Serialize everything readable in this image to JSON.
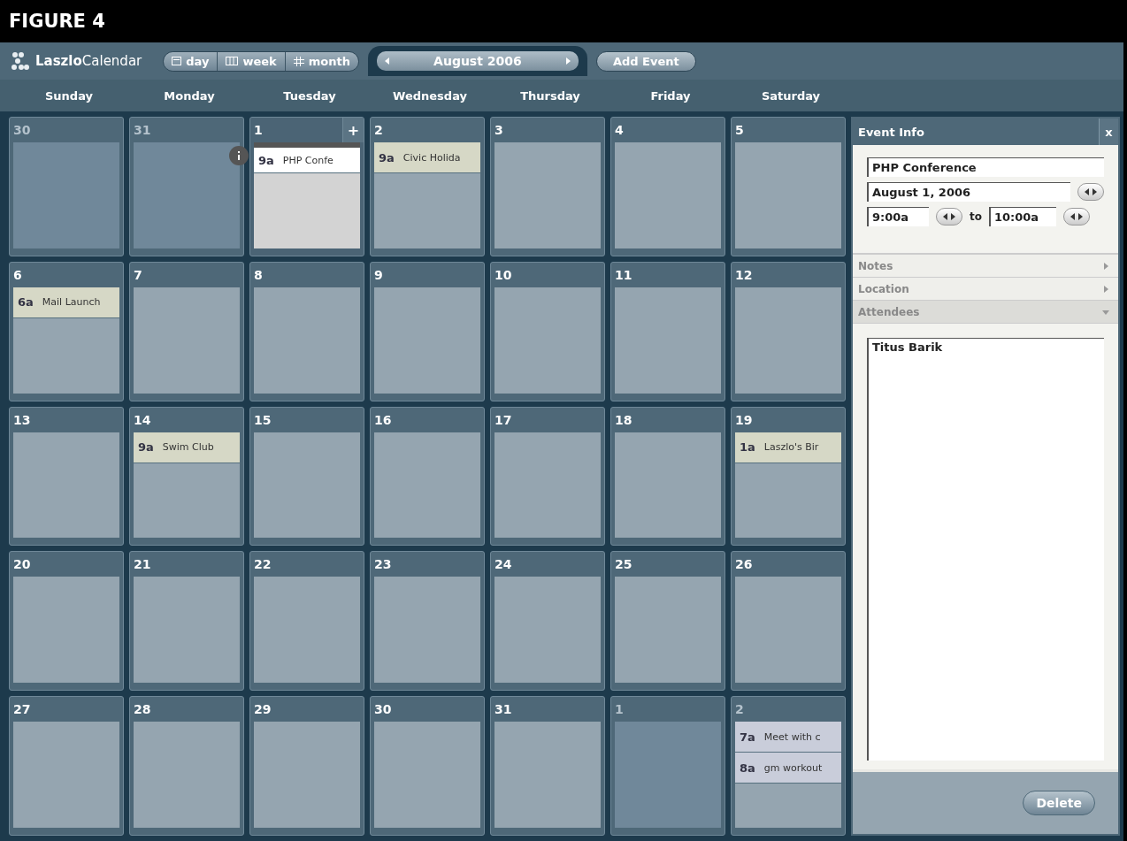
{
  "caption": "FIGURE 4",
  "toolbar": {
    "logo": "Laszlo",
    "logo_suffix": "Calendar",
    "views": [
      {
        "label": "day"
      },
      {
        "label": "week"
      },
      {
        "label": "month"
      }
    ],
    "period": "August 2006",
    "add_button": "Add Event"
  },
  "weekdays": [
    "Sunday",
    "Monday",
    "Tuesday",
    "Wednesday",
    "Thursday",
    "Friday",
    "Saturday"
  ],
  "weeks": [
    [
      {
        "day": "30",
        "muted": true,
        "selected": false
      },
      {
        "day": "31",
        "muted": true,
        "selected": false
      },
      {
        "day": "1",
        "muted": false,
        "selected": true,
        "add_label": "+",
        "events": [
          {
            "time": "9a",
            "title": "PHP Confe",
            "selected": true,
            "color": "#ffffff"
          }
        ]
      },
      {
        "day": "2",
        "muted": false,
        "selected": false,
        "events": [
          {
            "time": "9a",
            "title": "Civic Holida",
            "selected": false,
            "color": "#d6d8c6"
          }
        ]
      },
      {
        "day": "3",
        "muted": false,
        "selected": false
      },
      {
        "day": "4",
        "muted": false,
        "selected": false
      },
      {
        "day": "5",
        "muted": false,
        "selected": false
      }
    ],
    [
      {
        "day": "6",
        "muted": false,
        "selected": false,
        "events": [
          {
            "time": "6a",
            "title": "Mail Launch",
            "selected": false,
            "color": "#d6d8c6"
          }
        ]
      },
      {
        "day": "7",
        "muted": false,
        "selected": false
      },
      {
        "day": "8",
        "muted": false,
        "selected": false
      },
      {
        "day": "9",
        "muted": false,
        "selected": false
      },
      {
        "day": "10",
        "muted": false,
        "selected": false
      },
      {
        "day": "11",
        "muted": false,
        "selected": false
      },
      {
        "day": "12",
        "muted": false,
        "selected": false
      }
    ],
    [
      {
        "day": "13",
        "muted": false,
        "selected": false
      },
      {
        "day": "14",
        "muted": false,
        "selected": false,
        "events": [
          {
            "time": "9a",
            "title": "Swim Club",
            "selected": false,
            "color": "#d6d8c6"
          }
        ]
      },
      {
        "day": "15",
        "muted": false,
        "selected": false
      },
      {
        "day": "16",
        "muted": false,
        "selected": false
      },
      {
        "day": "17",
        "muted": false,
        "selected": false
      },
      {
        "day": "18",
        "muted": false,
        "selected": false
      },
      {
        "day": "19",
        "muted": false,
        "selected": false,
        "events": [
          {
            "time": "1a",
            "title": "Laszlo's Bir",
            "selected": false,
            "color": "#d6d8c6"
          }
        ]
      }
    ],
    [
      {
        "day": "20",
        "muted": false,
        "selected": false
      },
      {
        "day": "21",
        "muted": false,
        "selected": false
      },
      {
        "day": "22",
        "muted": false,
        "selected": false
      },
      {
        "day": "23",
        "muted": false,
        "selected": false
      },
      {
        "day": "24",
        "muted": false,
        "selected": false
      },
      {
        "day": "25",
        "muted": false,
        "selected": false
      },
      {
        "day": "26",
        "muted": false,
        "selected": false
      }
    ],
    [
      {
        "day": "27",
        "muted": false,
        "selected": false
      },
      {
        "day": "28",
        "muted": false,
        "selected": false
      },
      {
        "day": "29",
        "muted": false,
        "selected": false
      },
      {
        "day": "30",
        "muted": false,
        "selected": false
      },
      {
        "day": "31",
        "muted": false,
        "selected": false
      },
      {
        "day": "1",
        "muted": true,
        "selected": false
      },
      {
        "day": "2",
        "muted": true,
        "selected": false,
        "events": [
          {
            "time": "7a",
            "title": "Meet with c",
            "selected": false,
            "color": "#c9cdda"
          },
          {
            "time": "8a",
            "title": "gm workout",
            "selected": false,
            "color": "#c9cdda"
          }
        ]
      }
    ]
  ],
  "event_info": {
    "title": "Event Info",
    "close": "x",
    "name": "PHP Conference",
    "date": "August 1, 2006",
    "start": "9:00a",
    "to": "to",
    "end": "10:00a",
    "sections": [
      {
        "label": "Notes",
        "expanded": false
      },
      {
        "label": "Location",
        "expanded": false
      },
      {
        "label": "Attendees",
        "expanded": true
      }
    ],
    "attendees": "Titus Barik",
    "delete_button": "Delete"
  }
}
